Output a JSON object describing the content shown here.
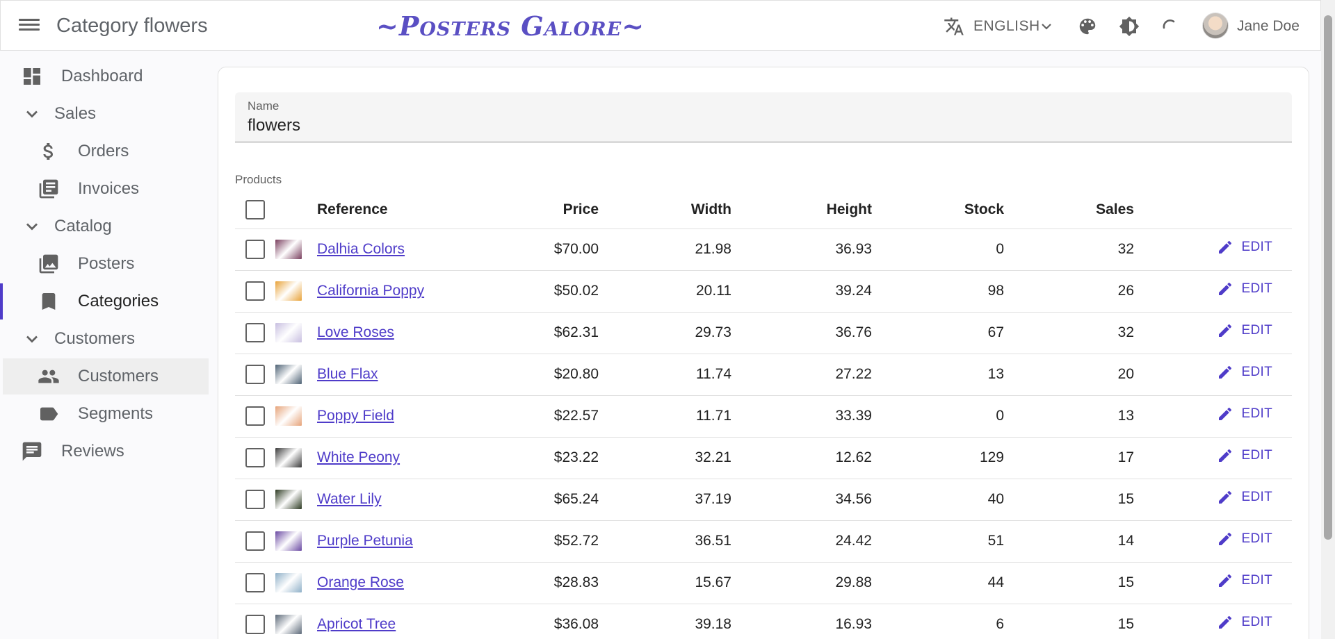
{
  "header": {
    "title": "Category flowers",
    "brand": "~Posters Galore~",
    "language": "ENGLISH",
    "user_name": "Jane Doe",
    "icons": [
      "menu-icon",
      "translate-icon",
      "chevron-down-icon",
      "palette-icon",
      "contrast-icon",
      "refresh-icon",
      "avatar"
    ]
  },
  "sidebar": {
    "items": [
      {
        "label": "Dashboard",
        "icon": "dashboard-icon"
      },
      {
        "label": "Sales",
        "icon": "chevron-down-icon"
      },
      {
        "label": "Orders",
        "icon": "dollar-icon"
      },
      {
        "label": "Invoices",
        "icon": "invoices-icon"
      },
      {
        "label": "Catalog",
        "icon": "chevron-down-icon"
      },
      {
        "label": "Posters",
        "icon": "image-icon"
      },
      {
        "label": "Categories",
        "icon": "bookmark-icon"
      },
      {
        "label": "Customers",
        "icon": "chevron-down-icon"
      },
      {
        "label": "Customers",
        "icon": "people-icon"
      },
      {
        "label": "Segments",
        "icon": "label-icon"
      },
      {
        "label": "Reviews",
        "icon": "comment-icon"
      }
    ]
  },
  "form": {
    "name_label": "Name",
    "name_value": "flowers",
    "products_label": "Products"
  },
  "table": {
    "headers": {
      "reference": "Reference",
      "price": "Price",
      "width": "Width",
      "height": "Height",
      "stock": "Stock",
      "sales": "Sales"
    },
    "edit_label": "EDIT",
    "rows": [
      {
        "reference": "Dalhia Colors",
        "price": "$70.00",
        "width": "21.98",
        "height": "36.93",
        "stock": "0",
        "sales": "32",
        "thumb": "#7a3f5e"
      },
      {
        "reference": "California Poppy",
        "price": "$50.02",
        "width": "20.11",
        "height": "39.24",
        "stock": "98",
        "sales": "26",
        "thumb": "#e8a33a"
      },
      {
        "reference": "Love Roses",
        "price": "$62.31",
        "width": "29.73",
        "height": "36.76",
        "stock": "67",
        "sales": "32",
        "thumb": "#c8bfe0"
      },
      {
        "reference": "Blue Flax",
        "price": "$20.80",
        "width": "11.74",
        "height": "27.22",
        "stock": "13",
        "sales": "20",
        "thumb": "#4e6275"
      },
      {
        "reference": "Poppy Field",
        "price": "$22.57",
        "width": "11.71",
        "height": "33.39",
        "stock": "0",
        "sales": "13",
        "thumb": "#e6a37a"
      },
      {
        "reference": "White Peony",
        "price": "$23.22",
        "width": "32.21",
        "height": "12.62",
        "stock": "129",
        "sales": "17",
        "thumb": "#3a3a3a"
      },
      {
        "reference": "Water Lily",
        "price": "$65.24",
        "width": "37.19",
        "height": "34.56",
        "stock": "40",
        "sales": "15",
        "thumb": "#2d3a22"
      },
      {
        "reference": "Purple Petunia",
        "price": "$52.72",
        "width": "36.51",
        "height": "24.42",
        "stock": "51",
        "sales": "14",
        "thumb": "#6b4aa3"
      },
      {
        "reference": "Orange Rose",
        "price": "$28.83",
        "width": "15.67",
        "height": "29.88",
        "stock": "44",
        "sales": "15",
        "thumb": "#8fb0c8"
      },
      {
        "reference": "Apricot Tree",
        "price": "$36.08",
        "width": "39.18",
        "height": "16.93",
        "stock": "6",
        "sales": "15",
        "thumb": "#5d6a7a"
      }
    ]
  },
  "colors": {
    "accent": "#4f3cc9",
    "brand": "#5a4fc3"
  }
}
